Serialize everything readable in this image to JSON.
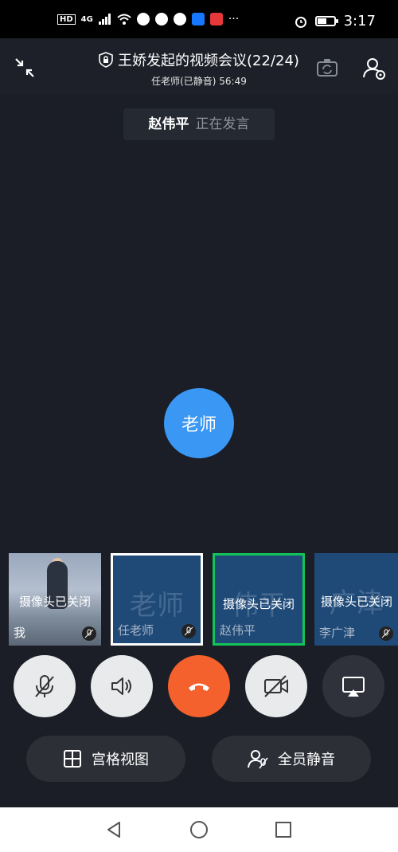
{
  "status_bar": {
    "network_label": "4G",
    "hd_label": "HD",
    "time": "3:17",
    "battery_percent": 60
  },
  "meeting": {
    "title": "王娇发起的视频会议(22/24)",
    "subtitle": "任老师(已静音) 56:49",
    "current_speaker": "赵伟平",
    "speaker_status": "正在发言",
    "center_avatar_text": "老师"
  },
  "thumbnails": [
    {
      "name": "我",
      "status": "摄像头已关闭",
      "big_text": "",
      "muted": true
    },
    {
      "name": "任老师",
      "status": "",
      "big_text": "老师",
      "muted": true
    },
    {
      "name": "赵伟平",
      "status": "摄像头已关闭",
      "big_text": "伟平",
      "muted": false
    },
    {
      "name": "李广津",
      "status": "摄像头已关闭",
      "big_text": "广津",
      "muted": true
    }
  ],
  "bottom_actions": {
    "grid_view_label": "宫格视图",
    "mute_all_label": "全员静音"
  },
  "colors": {
    "background": "#1b1e26",
    "avatar_blue": "#3a97f3",
    "hangup_orange": "#f4612d",
    "speaking_green": "#12c35a"
  }
}
